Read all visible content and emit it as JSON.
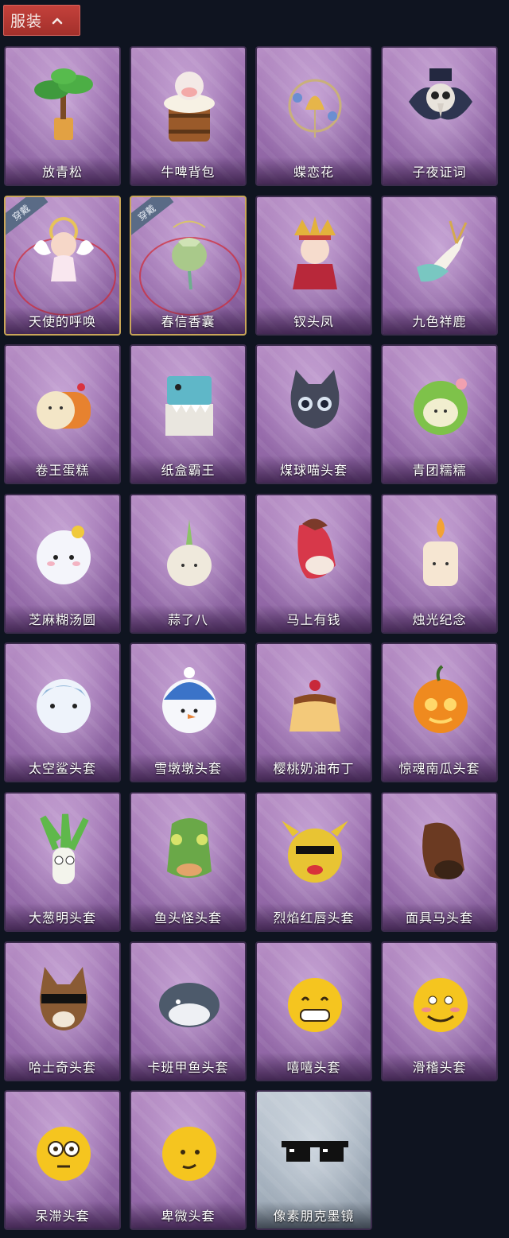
{
  "header": {
    "title": "服装",
    "chevron": "chevron-up-icon"
  },
  "worn_badge_text": "穿戴",
  "items": [
    {
      "name": "放青松",
      "icon": "bonsai-pine-icon",
      "worn": false,
      "gray": false
    },
    {
      "name": "牛啤背包",
      "icon": "cow-beer-barrel-icon",
      "worn": false,
      "gray": false
    },
    {
      "name": "蝶恋花",
      "icon": "butterfly-bell-ornament-icon",
      "worn": false,
      "gray": false
    },
    {
      "name": "子夜证词",
      "icon": "plague-doctor-mask-icon",
      "worn": false,
      "gray": false
    },
    {
      "name": "天使的呼唤",
      "icon": "angel-doll-icon",
      "worn": true,
      "gray": false
    },
    {
      "name": "春信香囊",
      "icon": "sachet-pouch-icon",
      "worn": true,
      "gray": false
    },
    {
      "name": "钗头凤",
      "icon": "phoenix-crown-doll-icon",
      "worn": false,
      "gray": false
    },
    {
      "name": "九色祥鹿",
      "icon": "deer-charm-icon",
      "worn": false,
      "gray": false
    },
    {
      "name": "卷王蛋糕",
      "icon": "roll-cake-icon",
      "worn": false,
      "gray": false
    },
    {
      "name": "纸盒霸王",
      "icon": "cardboard-dino-icon",
      "worn": false,
      "gray": false
    },
    {
      "name": "煤球喵头套",
      "icon": "black-cat-head-icon",
      "worn": false,
      "gray": false
    },
    {
      "name": "青团糯糯",
      "icon": "green-dumpling-icon",
      "worn": false,
      "gray": false
    },
    {
      "name": "芝麻糊汤圆",
      "icon": "white-dumpling-icon",
      "worn": false,
      "gray": false
    },
    {
      "name": "蒜了八",
      "icon": "garlic-icon",
      "worn": false,
      "gray": false
    },
    {
      "name": "马上有钱",
      "icon": "red-horse-head-icon",
      "worn": false,
      "gray": false
    },
    {
      "name": "烛光纪念",
      "icon": "candle-icon",
      "worn": false,
      "gray": false
    },
    {
      "name": "太空鲨头套",
      "icon": "shark-head-icon",
      "worn": false,
      "gray": false
    },
    {
      "name": "雪墩墩头套",
      "icon": "snowman-head-icon",
      "worn": false,
      "gray": false
    },
    {
      "name": "樱桃奶油布丁",
      "icon": "pudding-icon",
      "worn": false,
      "gray": false
    },
    {
      "name": "惊魂南瓜头套",
      "icon": "pumpkin-head-icon",
      "worn": false,
      "gray": false
    },
    {
      "name": "大葱明头套",
      "icon": "scallion-head-icon",
      "worn": false,
      "gray": false
    },
    {
      "name": "鱼头怪头套",
      "icon": "fish-head-icon",
      "worn": false,
      "gray": false
    },
    {
      "name": "烈焰红唇头套",
      "icon": "yellow-mascot-head-icon",
      "worn": false,
      "gray": false
    },
    {
      "name": "面具马头套",
      "icon": "horse-mask-icon",
      "worn": false,
      "gray": false
    },
    {
      "name": "哈士奇头套",
      "icon": "husky-head-icon",
      "worn": false,
      "gray": false
    },
    {
      "name": "卡班甲鱼头套",
      "icon": "turtle-head-icon",
      "worn": false,
      "gray": false
    },
    {
      "name": "嘻嘻头套",
      "icon": "grin-emoji-head-icon",
      "worn": false,
      "gray": false
    },
    {
      "name": "滑稽头套",
      "icon": "smirk-emoji-head-icon",
      "worn": false,
      "gray": false
    },
    {
      "name": "呆滞头套",
      "icon": "stare-emoji-head-icon",
      "worn": false,
      "gray": false
    },
    {
      "name": "卑微头套",
      "icon": "humble-emoji-head-icon",
      "worn": false,
      "gray": false
    },
    {
      "name": "像素朋克墨镜",
      "icon": "pixel-sunglasses-icon",
      "worn": false,
      "gray": true
    }
  ],
  "colors": {
    "background": "#0f1420",
    "header_red": "#b33832",
    "card_purple": "#9a6eae",
    "card_gray": "#a6b2bf",
    "worn_border": "#c9a658",
    "badge": "#5a6b86"
  }
}
